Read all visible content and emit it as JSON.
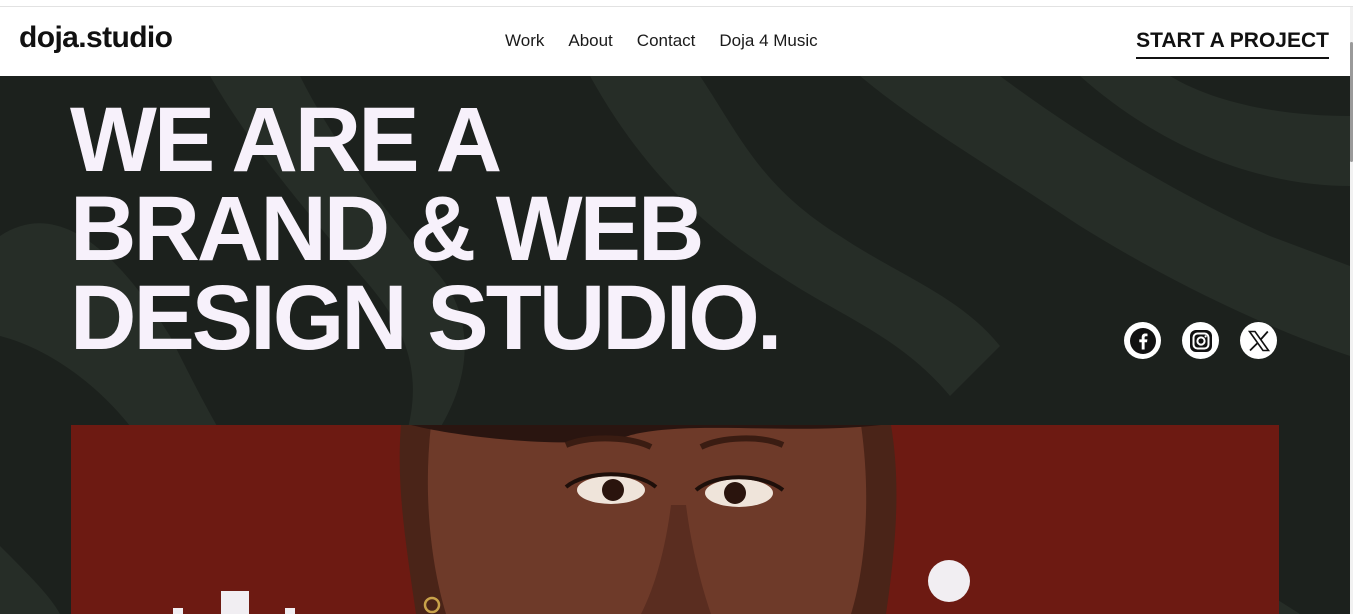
{
  "brand": {
    "logo_text": "doja.studio"
  },
  "nav": {
    "items": [
      "Work",
      "About",
      "Contact",
      "Doja 4 Music"
    ]
  },
  "cta": {
    "label": "START A PROJECT"
  },
  "hero": {
    "headline_lines": [
      "WE ARE A",
      "BRAND & WEB",
      "DESIGN STUDIO."
    ],
    "background_color": "#1c211d",
    "text_color": "#f7f1fb"
  },
  "socials": {
    "icons": [
      "facebook-icon",
      "instagram-icon",
      "x-icon"
    ]
  },
  "colors": {
    "accent_dark": "#1c211d",
    "photo_red": "#6f1b12",
    "white": "#ffffff"
  }
}
